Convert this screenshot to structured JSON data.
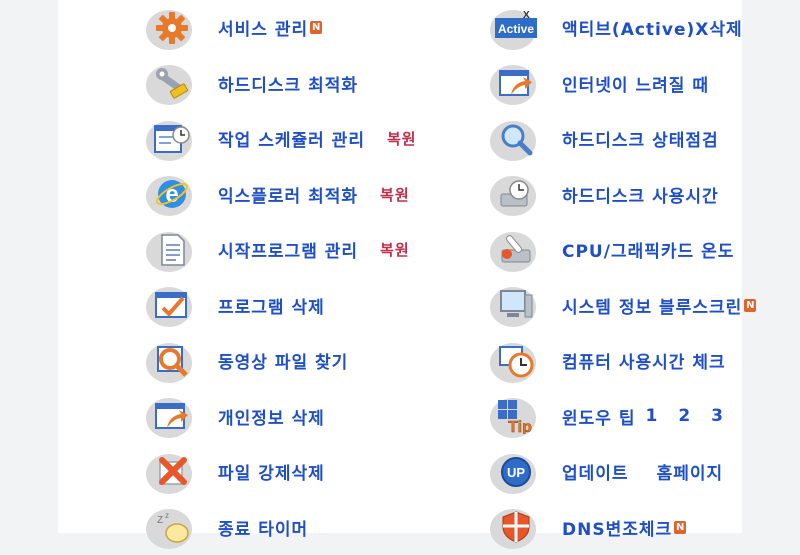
{
  "badge_new": "N",
  "left": [
    {
      "label": "서비스 관리",
      "icon": "gear-icon",
      "new": true
    },
    {
      "label": "하드디스크 최적화",
      "icon": "wrench-icon"
    },
    {
      "label": "작업 스케쥴러 관리",
      "icon": "scheduler-clock-icon",
      "restore": "복원"
    },
    {
      "label": "익스플로러 최적화",
      "icon": "internet-explorer-icon",
      "restore": "복원"
    },
    {
      "label": "시작프로그램 관리",
      "icon": "document-icon",
      "restore": "복원"
    },
    {
      "label": "프로그램 삭제",
      "icon": "checklist-icon"
    },
    {
      "label": "동영상 파일 찾기",
      "icon": "magnifier-icon"
    },
    {
      "label": "개인정보 삭제",
      "icon": "window-arrow-icon"
    },
    {
      "label": "파일 강제삭제",
      "icon": "red-x-icon"
    },
    {
      "label": "종료 타이머",
      "icon": "sleep-bubble-icon"
    }
  ],
  "right": [
    {
      "label": "액티브(Active)X삭제",
      "icon": "activex-icon",
      "icon_text": "Active",
      "icon_x": "X"
    },
    {
      "label": "인터넷이 느려질 때",
      "icon": "browser-arrow-icon"
    },
    {
      "label": "하드디스크 상태점검",
      "icon": "disk-magnifier-icon"
    },
    {
      "label": "하드디스크 사용시간",
      "icon": "disk-clock-icon"
    },
    {
      "label": "CPU/그래픽카드 온도",
      "icon": "thermometer-icon"
    },
    {
      "label": "시스템 정보 블루스크린",
      "icon": "computer-icon",
      "new": true
    },
    {
      "label": "컴퓨터 사용시간 체크",
      "icon": "clock-icon"
    },
    {
      "label": "윈도우 팁",
      "icon": "windows-tip-icon",
      "icon_text": "Tip",
      "links": [
        "1",
        "2",
        "3"
      ]
    },
    {
      "label": "업데이트",
      "icon": "update-icon",
      "icon_text": "UP",
      "extra": "홈페이지"
    },
    {
      "label": "DNS변조체크",
      "icon": "shield-icon",
      "new": true
    }
  ]
}
